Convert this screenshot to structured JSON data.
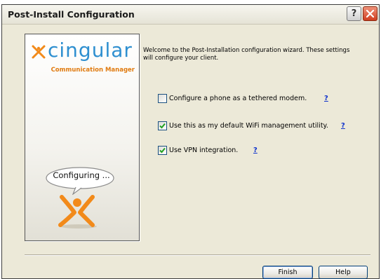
{
  "window": {
    "title": "Post-Install Configuration",
    "help_glyph": "?",
    "close_icon": "close-x-icon"
  },
  "side_panel": {
    "brand_name": "cingular",
    "brand_subtitle": "Communication Manager",
    "bubble_text": "Configuring ...",
    "brand_color": "#2e8fd0",
    "accent_color": "#e07b10"
  },
  "welcome_text": "Welcome to the Post-Installation configuration wizard.  These settings will configure your client.",
  "options": [
    {
      "label": "Configure a phone as a tethered modem.",
      "checked": false,
      "help": "?"
    },
    {
      "label": "Use this as my default WiFi management utility.",
      "checked": true,
      "help": "?"
    },
    {
      "label": "Use VPN integration.",
      "checked": true,
      "help": "?"
    }
  ],
  "buttons": {
    "finish": "Finish",
    "help": "Help"
  }
}
